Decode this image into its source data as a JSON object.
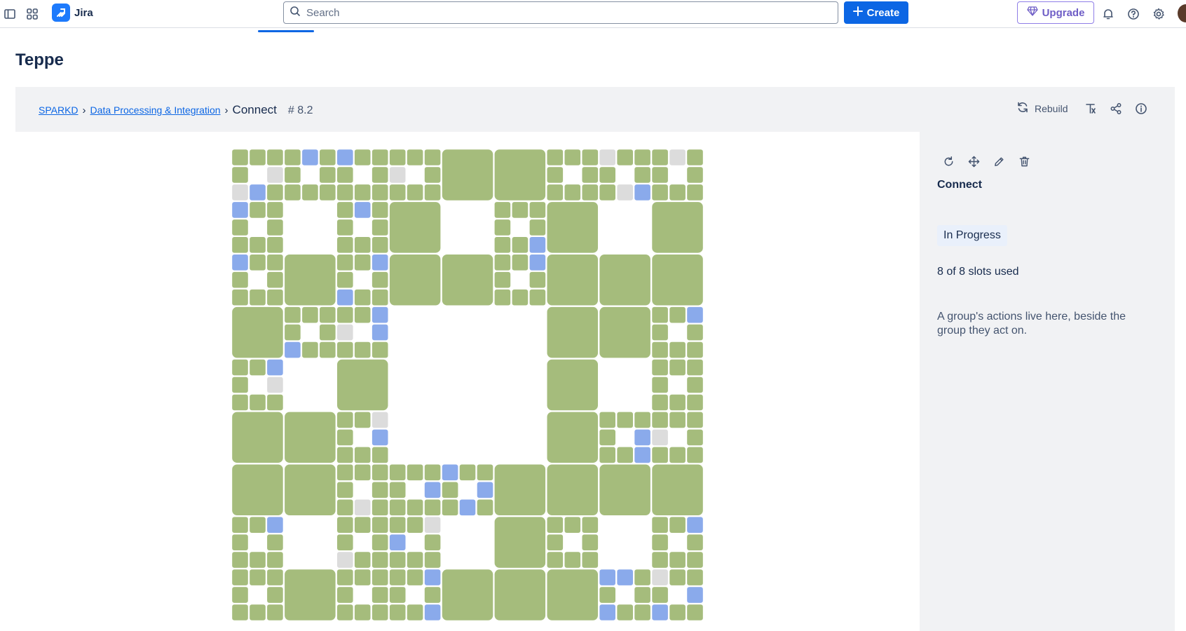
{
  "topbar": {
    "app_name": "Jira",
    "search": {
      "placeholder": "Search",
      "value": ""
    },
    "create_label": "Create",
    "upgrade_label": "Upgrade",
    "icons": [
      "sidebar-toggle-icon",
      "app-switcher-icon",
      "jira-logo-icon",
      "search-icon",
      "plus-icon",
      "gem-icon",
      "bell-icon",
      "help-icon",
      "settings-icon"
    ]
  },
  "page": {
    "title": "Teppe"
  },
  "breadcrumb": {
    "items": [
      "SPARKD",
      "Data Processing & Integration"
    ],
    "current": "Connect",
    "id": "# 8.2"
  },
  "header_actions": {
    "rebuild_label": "Rebuild",
    "icons": [
      "refresh-icon",
      "font-filter-icon",
      "share-icon",
      "info-icon"
    ]
  },
  "panel": {
    "tool_icons": [
      "rotate-icon",
      "move-icon",
      "edit-icon",
      "trash-icon"
    ],
    "title": "Connect",
    "status": "In Progress",
    "slots_text": "8 of 8 slots used",
    "note": "A group's actions live here, beside the group they act on."
  },
  "colors": {
    "tile_green": "#a5bc7c",
    "tile_blue": "#8aaaeb",
    "tile_gray": "#dcdcdc",
    "accent": "#0c66e4",
    "upgrade_purple": "#6e5dc6"
  },
  "grid": {
    "description_key": "sierpinski-carpet",
    "level2_big_blocks": [
      [
        1,
        0
      ],
      [
        1,
        1
      ],
      [
        0,
        1
      ]
    ],
    "highlight_cells": [
      [
        0,
        4,
        "b"
      ],
      [
        0,
        6,
        "b"
      ],
      [
        1,
        2,
        "g"
      ],
      [
        2,
        0,
        "g"
      ],
      [
        2,
        1,
        "b"
      ],
      [
        3,
        0,
        "b"
      ],
      [
        3,
        7,
        "b"
      ],
      [
        6,
        0,
        "b"
      ],
      [
        6,
        8,
        "b"
      ],
      [
        8,
        6,
        "b"
      ],
      [
        0,
        21,
        "g"
      ],
      [
        0,
        25,
        "g"
      ],
      [
        2,
        22,
        "g"
      ],
      [
        2,
        23,
        "b"
      ],
      [
        5,
        17,
        "b"
      ],
      [
        6,
        17,
        "b"
      ],
      [
        1,
        9,
        "g"
      ],
      [
        9,
        8,
        "b"
      ],
      [
        10,
        6,
        "g"
      ],
      [
        10,
        8,
        "b"
      ],
      [
        11,
        3,
        "b"
      ],
      [
        12,
        2,
        "b"
      ],
      [
        13,
        2,
        "g"
      ],
      [
        15,
        8,
        "g"
      ],
      [
        16,
        8,
        "b"
      ],
      [
        9,
        26,
        "b"
      ],
      [
        12,
        23,
        "b"
      ],
      [
        16,
        23,
        "b"
      ],
      [
        16,
        24,
        "g"
      ],
      [
        17,
        23,
        "b"
      ],
      [
        18,
        12,
        "b"
      ],
      [
        19,
        11,
        "b"
      ],
      [
        19,
        14,
        "b"
      ],
      [
        20,
        13,
        "b"
      ],
      [
        20,
        7,
        "g"
      ],
      [
        21,
        2,
        "b"
      ],
      [
        22,
        1,
        "b"
      ],
      [
        22,
        7,
        "b"
      ],
      [
        23,
        6,
        "g"
      ],
      [
        25,
        1,
        "g"
      ],
      [
        21,
        11,
        "g"
      ],
      [
        22,
        9,
        "b"
      ],
      [
        24,
        11,
        "b"
      ],
      [
        26,
        11,
        "b"
      ],
      [
        21,
        23,
        "g"
      ],
      [
        21,
        26,
        "b"
      ],
      [
        24,
        21,
        "b"
      ],
      [
        24,
        22,
        "b"
      ],
      [
        24,
        24,
        "g"
      ],
      [
        25,
        26,
        "b"
      ],
      [
        26,
        21,
        "b"
      ],
      [
        26,
        24,
        "b"
      ]
    ]
  }
}
